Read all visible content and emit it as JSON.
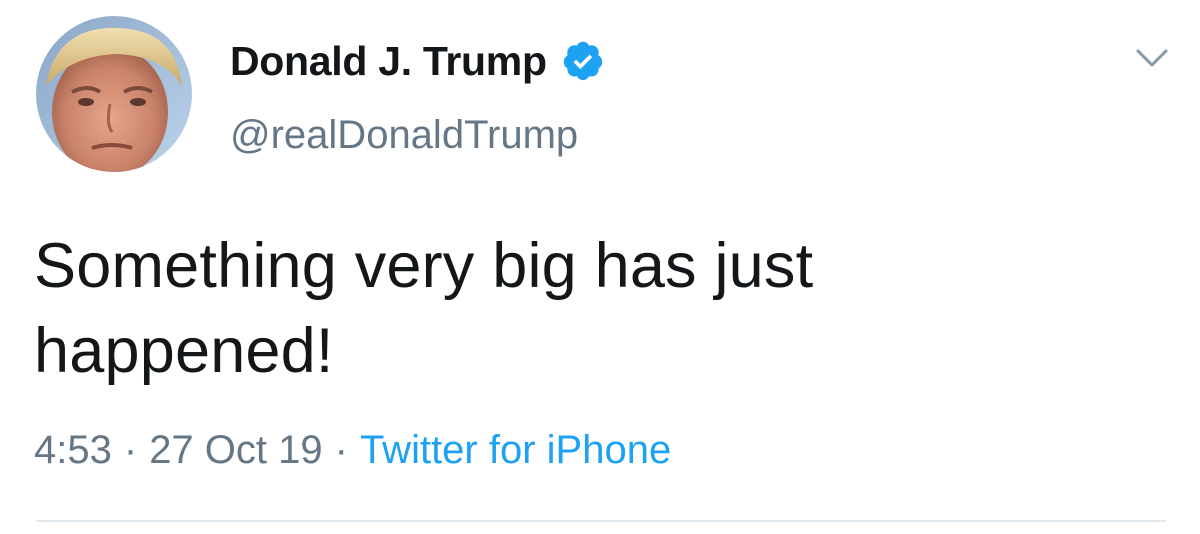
{
  "tweet": {
    "author": {
      "display_name": "Donald J. Trump",
      "handle": "@realDonaldTrump",
      "verified": true,
      "avatar": "profile-photo"
    },
    "text_line1": "Something very big has just",
    "text_line2": "happened!",
    "time": "4:53",
    "date": "27 Oct 19",
    "separator": "·",
    "source": "Twitter for iPhone",
    "menu_icon": "chevron-down-icon",
    "verified_icon": "verified-badge-icon"
  },
  "colors": {
    "text": "#14171a",
    "secondary_text": "#657786",
    "link": "#1da1f2",
    "verified": "#1da1f2",
    "divider": "#e1e8ed"
  }
}
